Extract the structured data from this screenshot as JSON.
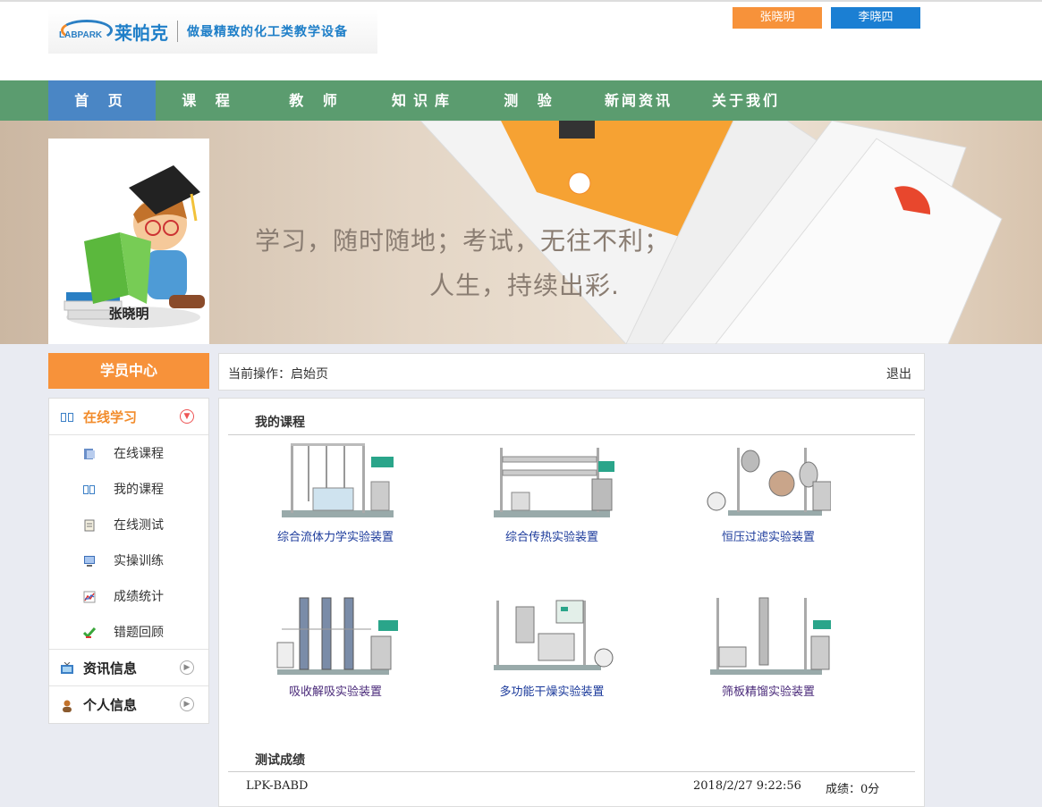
{
  "header": {
    "logo_en": "LABPARK",
    "logo_cn": "莱帕克",
    "slogan": "做最精致的化工类教学设备",
    "users": [
      "张晓明",
      "李晓四"
    ]
  },
  "nav": [
    "首 页",
    "课 程",
    "教 师",
    "知识库",
    "测 验",
    "新闻资讯",
    "关于我们"
  ],
  "banner": {
    "line1": "学习，随时随地；考试，无往不利；",
    "line2": "人生，持续出彩."
  },
  "profile": {
    "name": "张晓明"
  },
  "sidebar": {
    "title": "学员中心",
    "groups": [
      {
        "label": "在线学习",
        "items": [
          "在线课程",
          "我的课程",
          "在线测试",
          "实操训练",
          "成绩统计",
          "错题回顾"
        ]
      },
      {
        "label": "资讯信息"
      },
      {
        "label": "个人信息"
      }
    ]
  },
  "opbar": {
    "label": "当前操作：启始页",
    "logout": "退出"
  },
  "main": {
    "courses_title": "我的课程",
    "courses": [
      "综合流体力学实验装置",
      "综合传热实验装置",
      "恒压过滤实验装置",
      "吸收解吸实验装置",
      "多功能干燥实验装置",
      "筛板精馏实验装置"
    ],
    "scores_title": "测试成绩",
    "score": {
      "code": "LPK-BABD",
      "time": "2018/2/27 9:22:56",
      "label": "成绩：",
      "value": "0分"
    }
  }
}
